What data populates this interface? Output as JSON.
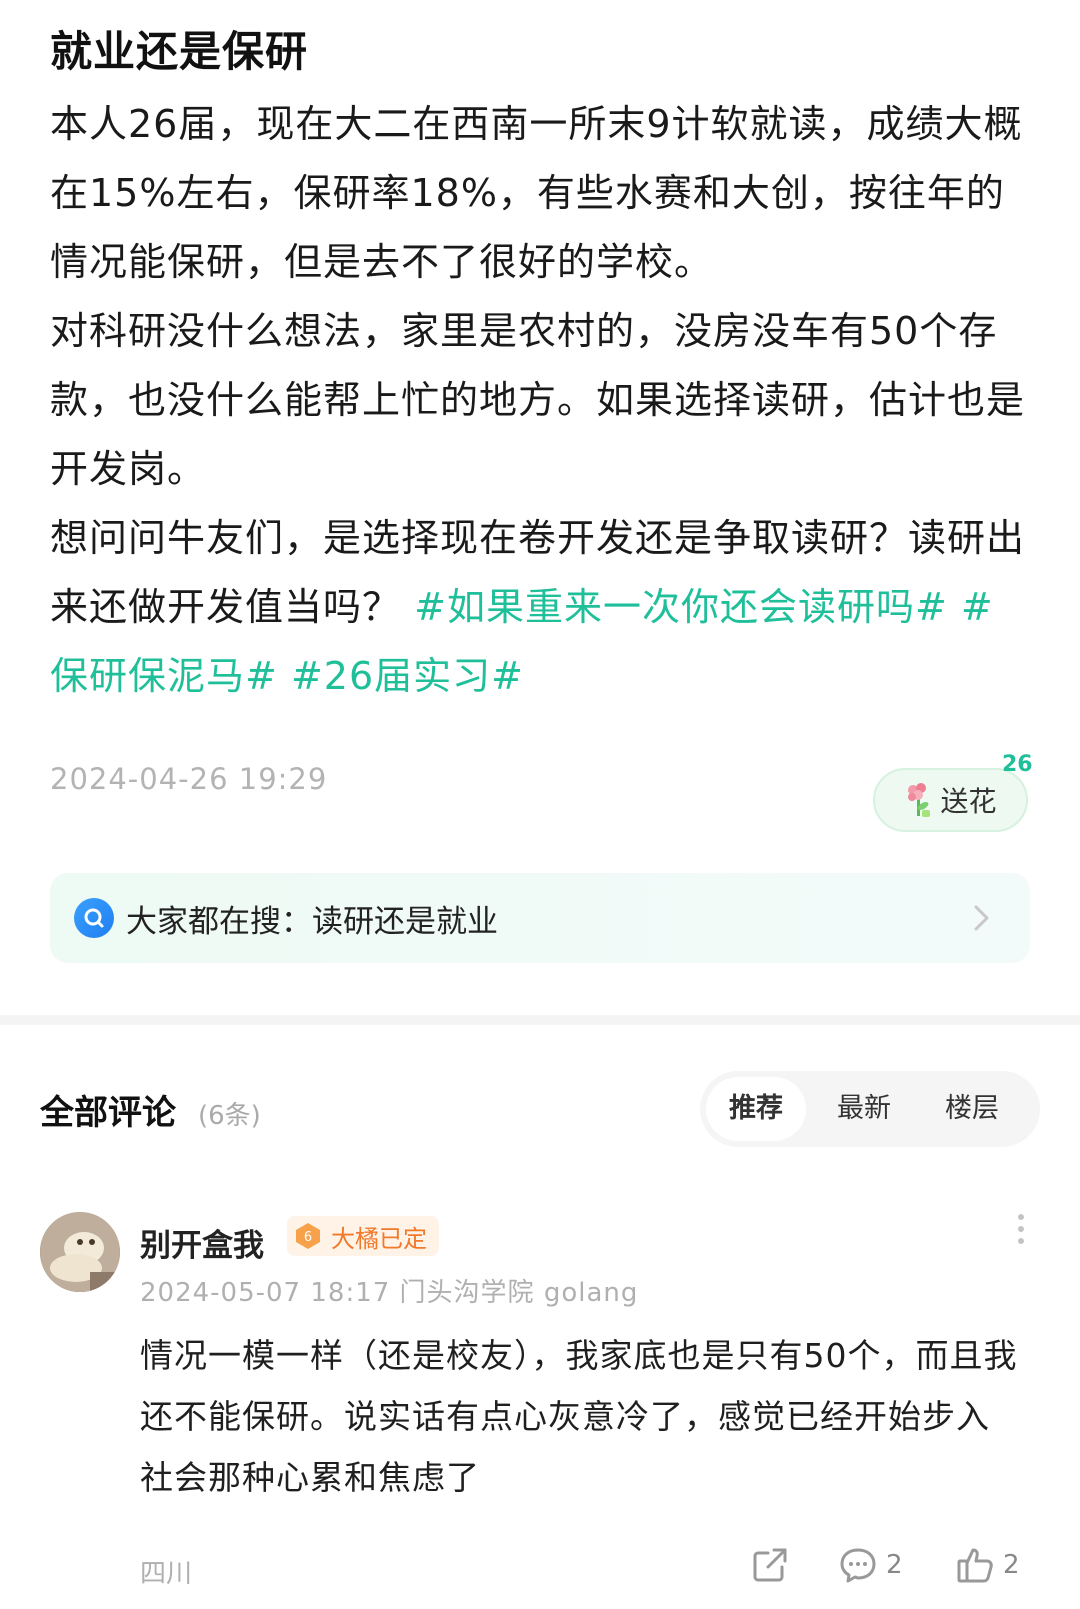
{
  "post": {
    "title": "就业还是保研",
    "paragraph1": "本人26届，现在大二在西南一所末9计软就读，成绩大概在15%左右，保研率18%，有些水赛和大创，按往年的情况能保研，但是去不了很好的学校。",
    "paragraph2": "对科研没什么想法，家里是农村的，没房没车有50个存款，也没什么能帮上忙的地方。如果选择读研，估计也是开发岗。",
    "paragraph3_text": "想问问牛友们，是选择现在卷开发还是争取读研？读研出来还做开发值当吗？",
    "tags": [
      "#如果重来一次你还会读研吗#",
      "#保研保泥马#",
      "#26届实习#"
    ],
    "time": "2024-04-26 19:29",
    "flower": {
      "label": "送花",
      "count": "26",
      "icon": "flower-icon"
    }
  },
  "search_suggestion": {
    "text": "大家都在搜：读研还是就业",
    "icon": "search-icon"
  },
  "comments_section": {
    "title": "全部评论",
    "count": "(6条)",
    "sort_tabs": [
      {
        "label": "推荐",
        "active": true
      },
      {
        "label": "最新",
        "active": false
      },
      {
        "label": "楼层",
        "active": false
      }
    ]
  },
  "comment": {
    "username": "别开盒我",
    "level": "6",
    "badge_text": "大橘已定",
    "meta": "2024-05-07 18:17 门头沟学院 golang",
    "text": "情况一模一样（还是校友），我家底也是只有50个，而且我还不能保研。说实话有点心灰意冷了，感觉已经开始步入社会那种心累和焦虑了",
    "location": "四川",
    "reply_count": "2",
    "like_count": "2"
  },
  "colors": {
    "accent": "#1fbf9a",
    "badge_orange": "#f07a2a"
  }
}
